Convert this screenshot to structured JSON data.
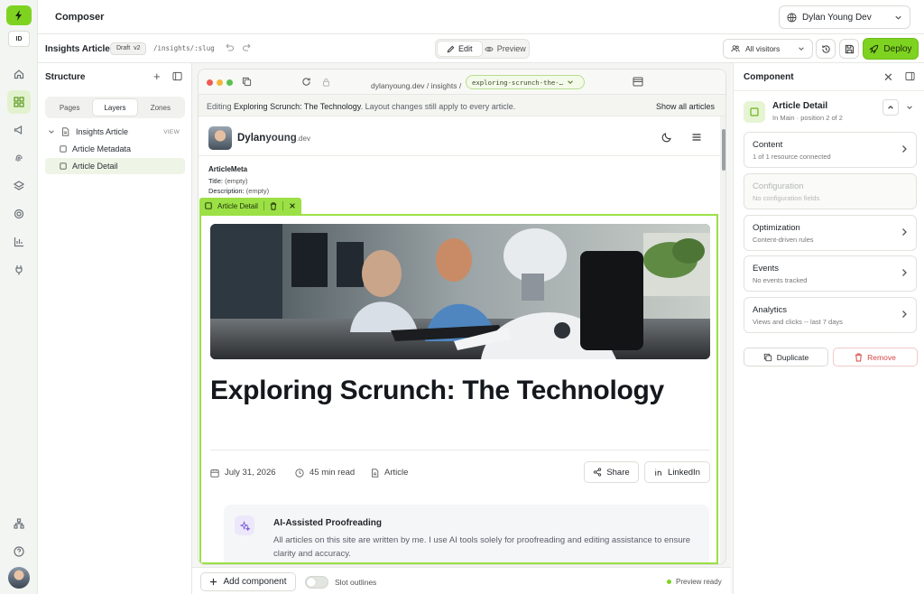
{
  "app": {
    "title": "Composer",
    "workspace_badge": "ID"
  },
  "user": {
    "name": "Dylan Young Dev"
  },
  "rail": {
    "items": [
      "home-icon",
      "grid-icon",
      "megaphone-icon",
      "fingerprint-icon",
      "layers-icon",
      "target-icon",
      "bar-chart-icon",
      "plug-icon",
      "sitemap-icon",
      "help-icon"
    ]
  },
  "toolbar": {
    "doc_title": "Insights Article",
    "draft_badge": "Draft",
    "draft_version": "v2",
    "slug": "/insights/:slug",
    "edit_label": "Edit",
    "preview_label": "Preview",
    "audience": "All visitors",
    "deploy_label": "Deploy"
  },
  "structure": {
    "title": "Structure",
    "tabs": [
      {
        "label": "Pages"
      },
      {
        "label": "Layers",
        "active": true
      },
      {
        "label": "Zones"
      }
    ],
    "tree": [
      {
        "label": "Insights Article",
        "tag": "VIEW"
      },
      {
        "label": "Article Metadata"
      },
      {
        "label": "Article Detail",
        "selected": true
      }
    ]
  },
  "browser": {
    "url_host": "dylanyoung.dev",
    "url_path": "insights",
    "url_slug": "exploring-scrunch-the-…",
    "edit_note_prefix": "Editing",
    "edit_note_page": "Exploring Scrunch: The Technology",
    "edit_note_suffix": ". Layout changes still apply to every article.",
    "show_all": "Show all articles"
  },
  "site": {
    "brand_first": "Dylan",
    "brand_last": "young",
    "brand_tld": ".dev"
  },
  "meta_block": {
    "title": "ArticleMeta",
    "title_label": "Title:",
    "title_value": "(empty)",
    "desc_label": "Description:",
    "desc_value": "(empty)"
  },
  "selection": {
    "label": "Article Detail"
  },
  "article": {
    "title": "Exploring Scrunch: The Technology",
    "date": "July 31, 2026",
    "read_time": "45 min read",
    "type": "Article",
    "share_label": "Share",
    "linkedin_label": "LinkedIn",
    "ai_title": "AI-Assisted Proofreading",
    "ai_text": "All articles on this site are written by me. I use AI tools solely for proofreading and editing assistance to ensure clarity and accuracy."
  },
  "bottom": {
    "add_label": "Add component",
    "outlines_label": "Slot outlines",
    "status": "Preview ready"
  },
  "component": {
    "panel_title": "Component",
    "name": "Article Detail",
    "position": "In Main · position 2 of 2",
    "cards": [
      {
        "title": "Content",
        "sub": "1 of 1 resource connected",
        "disabled": false
      },
      {
        "title": "Configuration",
        "sub": "No configuration fields",
        "disabled": true
      },
      {
        "title": "Optimization",
        "sub": "Content-driven rules",
        "disabled": false
      },
      {
        "title": "Events",
        "sub": "No events tracked",
        "disabled": false
      },
      {
        "title": "Analytics",
        "sub": "Views and clicks -- last 7 days",
        "disabled": false
      }
    ],
    "duplicate_label": "Duplicate",
    "remove_label": "Remove"
  },
  "colors": {
    "accent": "#7ed321",
    "selection": "#9be045",
    "danger": "#d64545"
  }
}
